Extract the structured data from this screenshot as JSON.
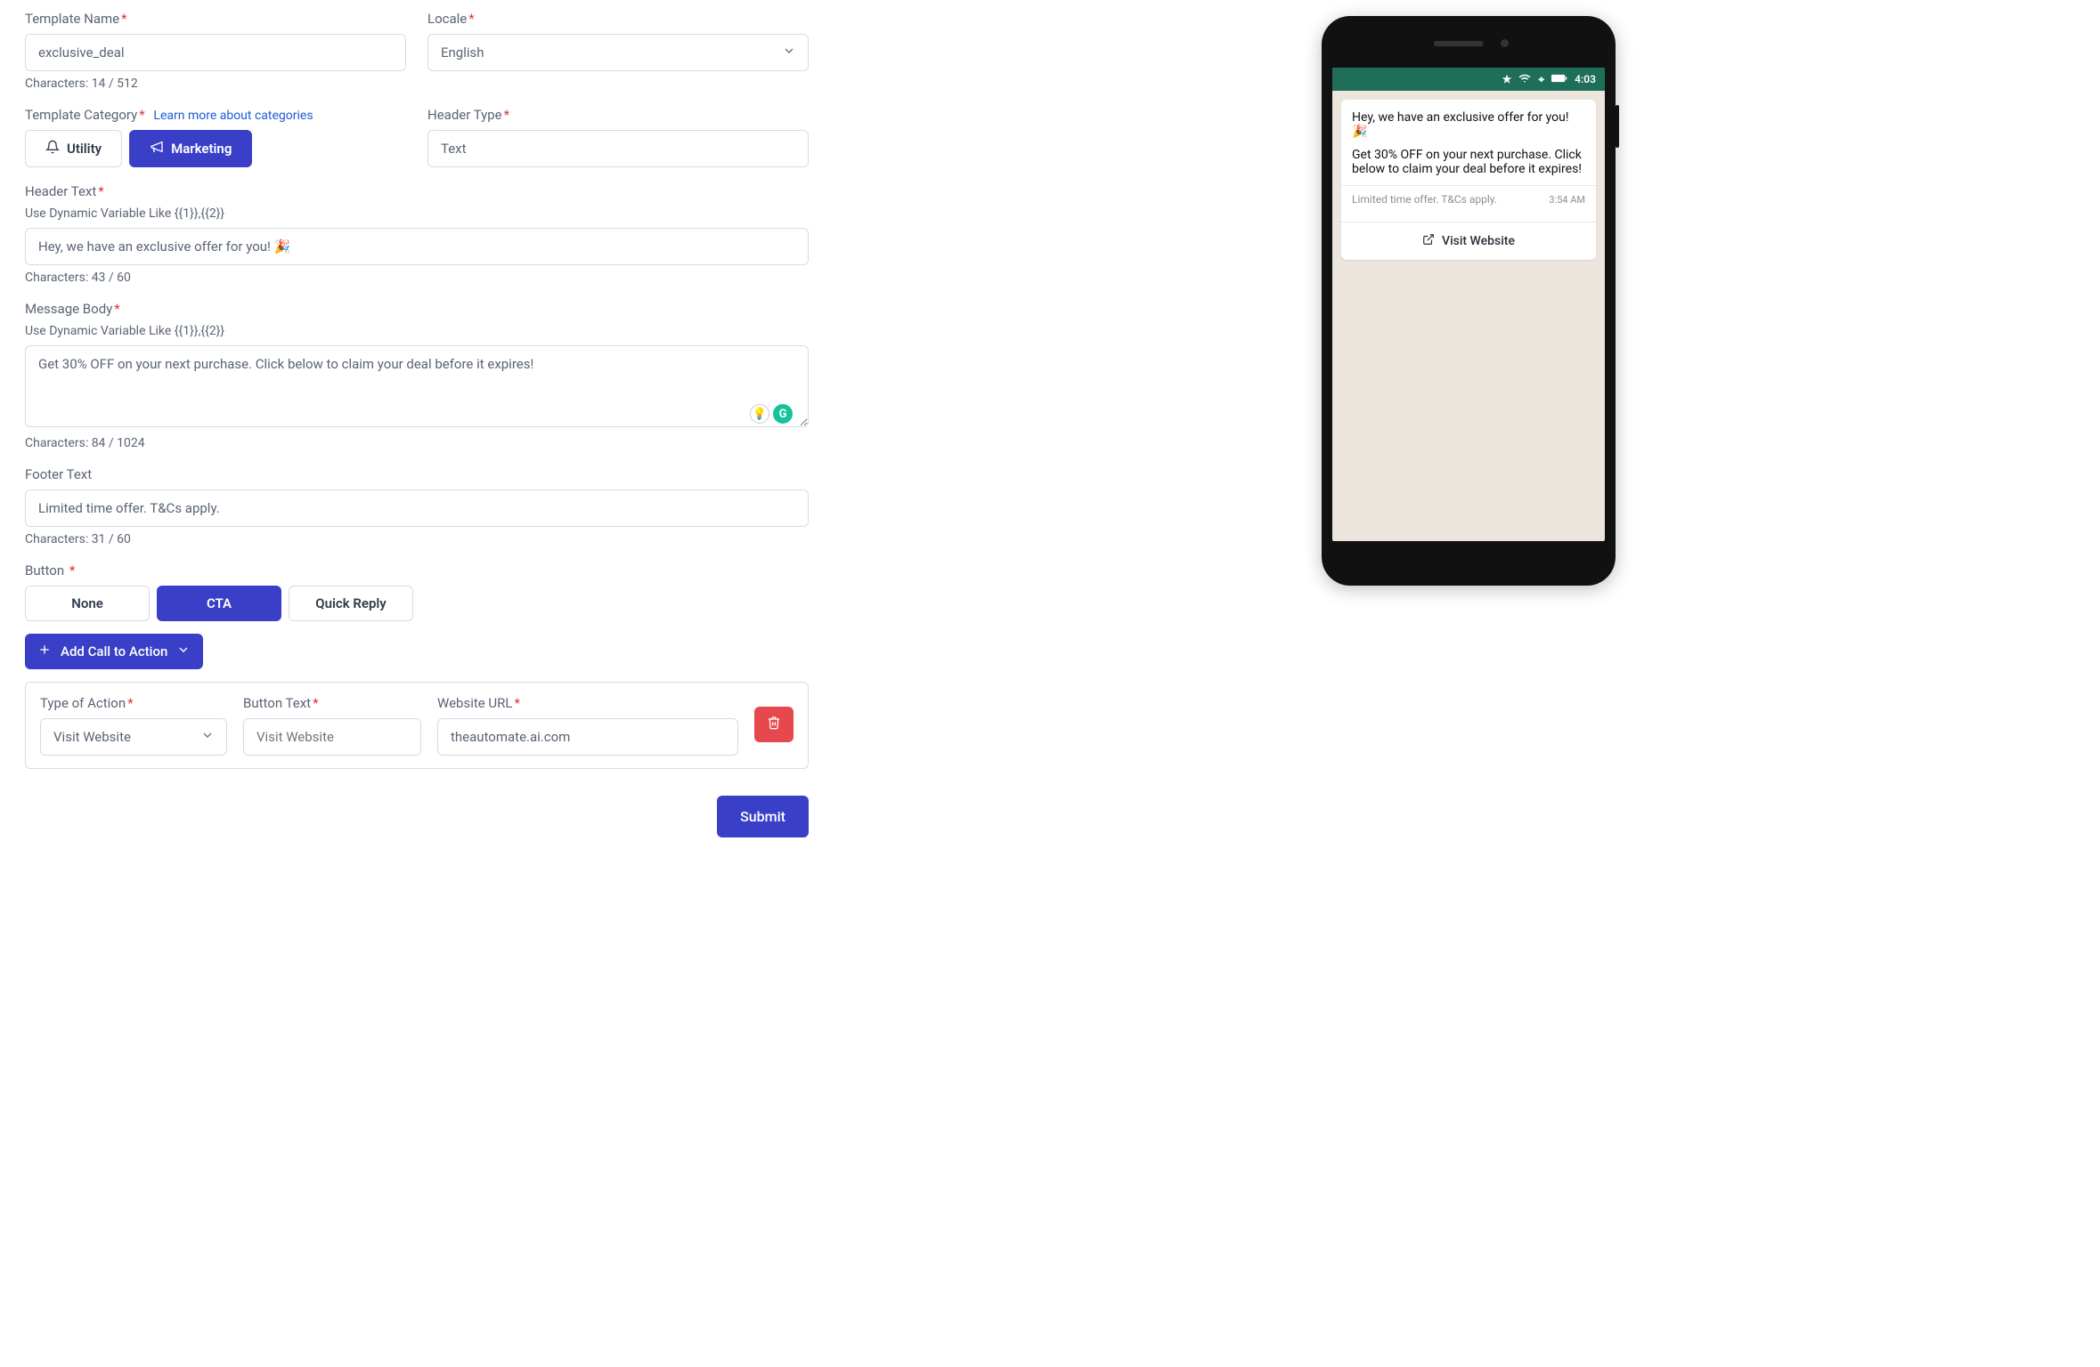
{
  "templateName": {
    "label": "Template Name",
    "value": "exclusive_deal",
    "counter": "Characters: 14 / 512"
  },
  "locale": {
    "label": "Locale",
    "selected": "English"
  },
  "category": {
    "label": "Template Category",
    "learnMore": "Learn more about categories",
    "options": {
      "utility": "Utility",
      "marketing": "Marketing"
    },
    "active": "marketing"
  },
  "headerType": {
    "label": "Header Type",
    "value": "Text"
  },
  "headerText": {
    "label": "Header Text",
    "hint": "Use Dynamic Variable Like {{1}},{{2}}",
    "value": "Hey, we have an exclusive offer for you! 🎉",
    "counter": "Characters: 43 / 60"
  },
  "messageBody": {
    "label": "Message Body",
    "hint": "Use Dynamic Variable Like {{1}},{{2}}",
    "value": "Get 30% OFF on your next purchase. Click below to claim your deal before it expires!",
    "counter": "Characters: 84 / 1024"
  },
  "footerText": {
    "label": "Footer Text",
    "value": "Limited time offer. T&Cs apply.",
    "counter": "Characters: 31 / 60"
  },
  "buttonSection": {
    "label": "Button",
    "options": {
      "none": "None",
      "cta": "CTA",
      "quick": "Quick Reply"
    },
    "active": "cta",
    "addLabel": "Add Call to Action",
    "row": {
      "typeLabel": "Type of Action",
      "typeValue": "Visit Website",
      "textLabel": "Button Text",
      "textPlaceholder": "Visit Website",
      "urlLabel": "Website URL",
      "urlValue": "theautomate.ai.com"
    }
  },
  "submit": "Submit",
  "preview": {
    "time": "4:03",
    "header": "Hey, we have an exclusive offer for you! 🎉",
    "body": "Get 30% OFF on your next purchase. Click below to claim your deal before it expires!",
    "footer": "Limited time offer. T&Cs apply.",
    "msgTime": "3:54 AM",
    "cta": "Visit Website"
  }
}
